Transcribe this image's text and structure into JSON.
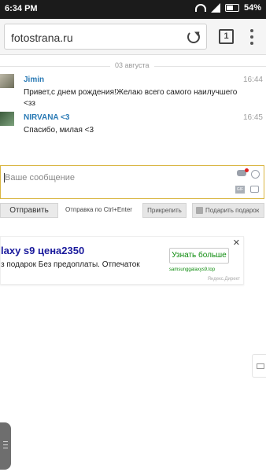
{
  "status_bar": {
    "time": "6:34 PM",
    "battery": "54%"
  },
  "browser": {
    "url": "fotostrana.ru",
    "tab_count": "1"
  },
  "chat": {
    "date": "03 августа",
    "messages": [
      {
        "name": "Jimin",
        "time": "16:44",
        "text_line1": "Привет,с днем рождения!Желаю всего самого наилучшего",
        "text_line2": "<зз"
      },
      {
        "name": "NIRVANA <3",
        "time": "16:45",
        "text_line1": "Спасибо, милая <3",
        "text_line2": ""
      }
    ]
  },
  "composer": {
    "placeholder": "Ваше сообщение",
    "gif_label": "GIF"
  },
  "actions": {
    "send_label": "Отправить",
    "send_hint": "Отправка по Ctrl+Enter",
    "attach_label": "Прикрепить",
    "gift_label": "Подарить подарок"
  },
  "ad": {
    "title": "laxy s9 цена2350",
    "text": "з подарок Без предоплаты. Отпечаток",
    "button_label": "Узнать больше",
    "domain": "samsunggalaxys9.top",
    "source": "Яндекс.Директ",
    "close": "✕"
  }
}
